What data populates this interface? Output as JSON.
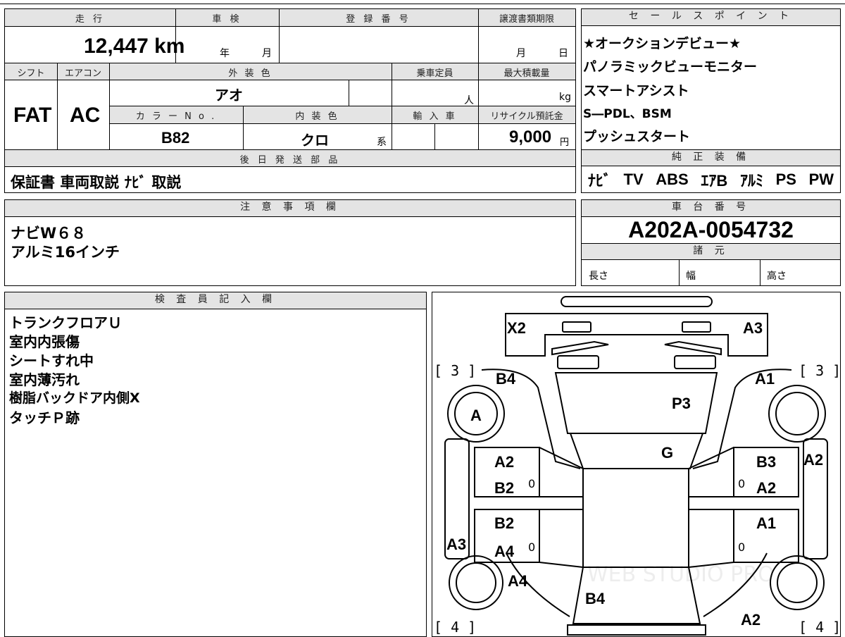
{
  "vehicle": {
    "labels": {
      "mileage": "走 行",
      "inspection": "車 検",
      "registration": "登 録 番 号",
      "transfer_deadline": "譲渡書類期限",
      "shift": "シフト",
      "aircon": "エアコン",
      "exterior_color": "外 装 色",
      "capacity": "乗車定員",
      "max_load": "最大積載量",
      "color_no": "カ ラ ー N o .",
      "interior_color": "内 装 色",
      "import": "輸 入 車",
      "recycle": "リサイクル預託金",
      "later_parts": "後 日 発 送 部 品",
      "notes": "注 意 事 項 欄",
      "inspector": "検 査 員 記 入 欄",
      "sales_points": "セ ー ル ス ポ イ ン ト",
      "equipment": "純 正 装 備",
      "chassis": "車 台 番 号",
      "specs": "諸 元"
    },
    "mileage": "12,447 km",
    "year_unit": "年",
    "month_unit": "月",
    "deadline_month": "月",
    "deadline_day": "日",
    "shift": "FAT",
    "aircon": "AC",
    "exterior_color": "アオ",
    "person_unit": "人",
    "kg_unit": "kg",
    "color_no": "B82",
    "interior_color": "クロ",
    "interior_suffix": "系",
    "recycle_value": "9,000",
    "yen_unit": "円",
    "later_parts": "保証書 車両取説 ﾅﾋﾞ 取説",
    "notes": [
      "ナビW６８",
      "アルミ16インチ"
    ],
    "inspector_notes": [
      "トランクフロアＵ",
      "室内内張傷",
      "シートすれ中",
      "室内薄汚れ",
      "樹脂バックドア内側X",
      "タッチＰ跡"
    ],
    "sales_points": [
      "★オークションデビュー★",
      "パノラミックビューモニター",
      "スマートアシスト",
      "S―PDL、BSM",
      "プッシュスタート"
    ],
    "equipment": [
      "ﾅﾋﾞ",
      "TV",
      "ABS",
      "ｴｱB",
      "ｱﾙﾐ",
      "PS",
      "PW"
    ],
    "chassis_no": "A202A-0054732",
    "spec_length": "長さ",
    "spec_width": "幅",
    "spec_height": "高さ"
  },
  "diagram": {
    "marks": {
      "x2": "X2",
      "a3_top": "A3",
      "b4_left": "B4",
      "a1_right": "A1",
      "p3": "P3",
      "a_wheel": "A",
      "g": "G",
      "a2_l": "A2",
      "b2_l": "B2",
      "b3_r": "B3",
      "a2_r": "A2",
      "a2_far": "A2",
      "b2_l2": "B2",
      "a4_l": "A4",
      "a1_r2": "A1",
      "a3_far": "A3",
      "a4_wheel": "A4",
      "b4_rear": "B4",
      "a2_rear": "A2",
      "zero1": "0",
      "zero2": "0",
      "zero3": "0",
      "zero4": "0"
    },
    "tire_front_left": "[ 3 ]",
    "tire_front_right": "[ 3 ]",
    "tire_rear_left": "[ 4 ]",
    "tire_rear_right": "[ 4 ]",
    "watermark": "WEB STUDIO PRO"
  }
}
